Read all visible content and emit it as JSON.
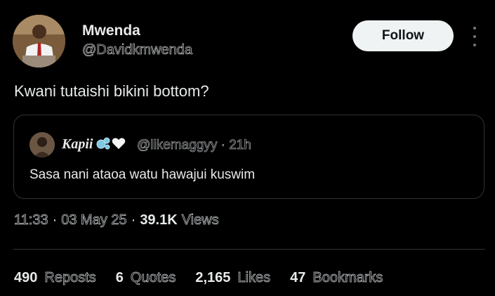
{
  "author": {
    "name": "Mwenda",
    "handle": "@Davidkmwenda"
  },
  "follow_label": "Follow",
  "tweet_text": "Kwani tutaishi bikini bottom?",
  "quote": {
    "name": "Kapii",
    "emoji": "🫧🤍",
    "handle": "@likemaggyy",
    "time": "21h",
    "text": "Sasa nani ataoa watu hawajui kuswim"
  },
  "meta": {
    "time": "11:33",
    "date": "03 May 25",
    "views_count": "39.1K",
    "views_label": "Views"
  },
  "stats": [
    {
      "value": "490",
      "label": "Reposts"
    },
    {
      "value": "6",
      "label": "Quotes"
    },
    {
      "value": "2,165",
      "label": "Likes"
    },
    {
      "value": "47",
      "label": "Bookmarks"
    }
  ],
  "colors": {
    "background": "#000000",
    "text": "#e7e9ea",
    "secondary": "#71767b",
    "border": "#2f3336",
    "follow_bg": "#eff3f4"
  }
}
